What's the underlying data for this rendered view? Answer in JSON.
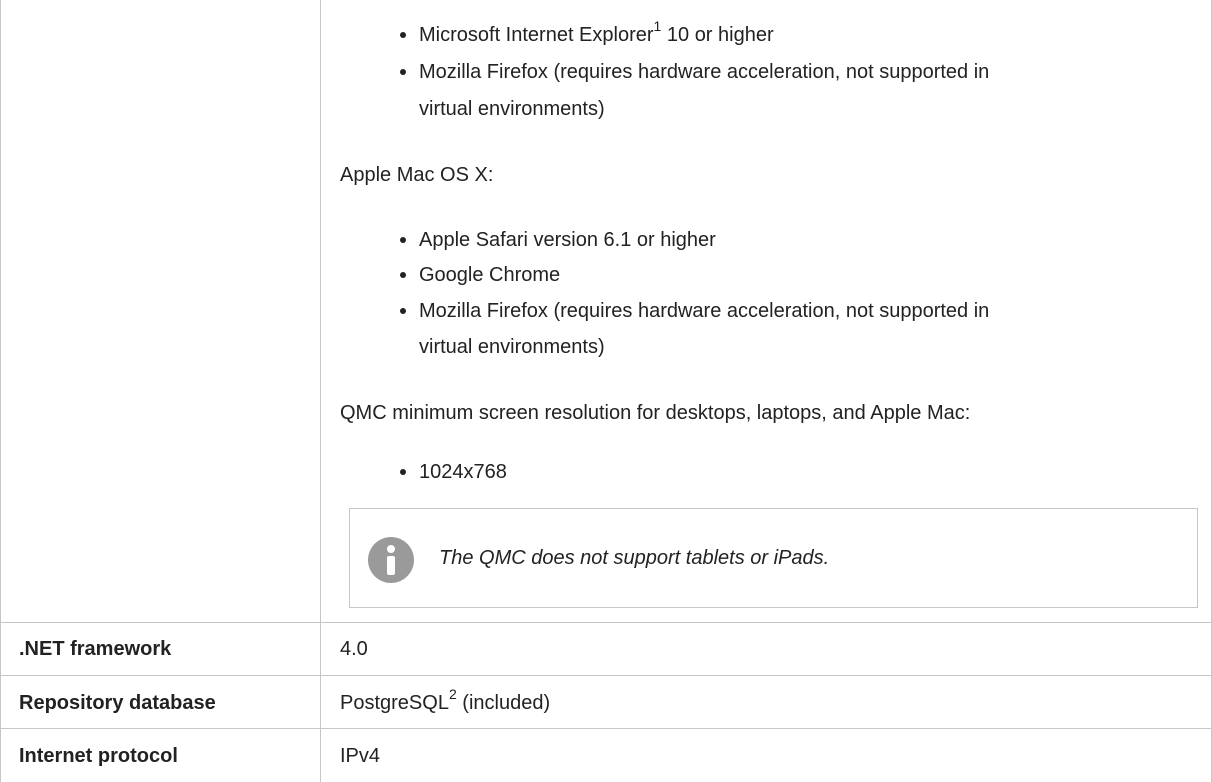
{
  "browsers": {
    "windows_items": [
      {
        "before": "Microsoft Internet Explorer",
        "sup": "1",
        "after": " 10 or higher"
      },
      {
        "line1": "Mozilla Firefox (requires hardware acceleration, not supported in",
        "line2": "virtual environments)"
      }
    ],
    "mac_heading": "Apple Mac OS X:",
    "mac_items": [
      "Apple Safari version 6.1 or higher",
      "Google Chrome"
    ],
    "mac_firefox": {
      "line1": "Mozilla Firefox (requires hardware acceleration, not supported in",
      "line2": "virtual environments)"
    },
    "resolution_heading": "QMC minimum screen resolution for desktops, laptops, and Apple Mac:",
    "resolution_items": [
      "1024x768"
    ],
    "note": "The QMC does not support tablets or iPads."
  },
  "rows": [
    {
      "label": ".NET framework",
      "value": "4.0"
    },
    {
      "label": "Repository database",
      "value_before": "PostgreSQL",
      "value_sup": "2",
      "value_after": " (included)"
    },
    {
      "label": "Internet protocol",
      "value": "IPv4"
    }
  ]
}
